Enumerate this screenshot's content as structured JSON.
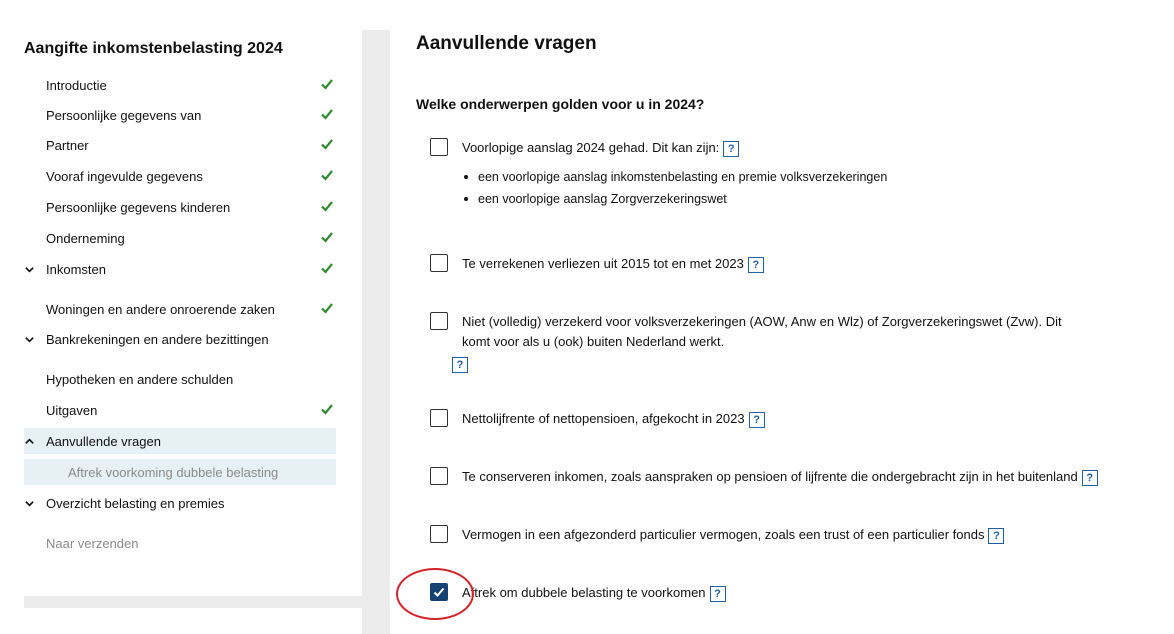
{
  "sidebar": {
    "title": "Aangifte inkomstenbelasting 2024",
    "items": [
      {
        "label": "Introductie",
        "done": true
      },
      {
        "label": "Persoonlijke gegevens van",
        "done": true
      },
      {
        "label": "Partner",
        "done": true
      },
      {
        "label": "Vooraf ingevulde gegevens",
        "done": true
      },
      {
        "label": "Persoonlijke gegevens kinderen",
        "done": true
      },
      {
        "label": "Onderneming",
        "done": true
      },
      {
        "label": "Inkomsten",
        "done": true,
        "expandable": true
      },
      {
        "label": "Woningen en andere onroerende zaken",
        "done": true
      },
      {
        "label": "Bankrekeningen en andere bezittingen",
        "done": false,
        "expandable": true
      },
      {
        "label": "Hypotheken en andere schulden",
        "done": false
      },
      {
        "label": "Uitgaven",
        "done": true
      },
      {
        "label": "Aanvullende vragen",
        "done": false,
        "expandable": true,
        "expanded": true
      },
      {
        "label": "Overzicht belasting en premies",
        "done": false,
        "expandable": true
      },
      {
        "label": "Naar verzenden",
        "done": false,
        "disabled": true
      }
    ],
    "subitem": "Aftrek voorkoming dubbele belasting"
  },
  "main": {
    "title": "Aanvullende vragen",
    "question": "Welke onderwerpen golden voor u in 2024?",
    "help_label": "?",
    "options": [
      {
        "text": "Voorlopige aanslag 2024 gehad. Dit kan zijn:",
        "checked": false,
        "bullets": [
          "een voorlopige aanslag inkomstenbelasting en premie volksverzekeringen",
          "een voorlopige aanslag Zorgverzekeringswet"
        ]
      },
      {
        "text": "Te verrekenen verliezen uit 2015 tot en met 2023",
        "checked": false
      },
      {
        "text": "Niet (volledig) verzekerd voor volksverzekeringen (AOW, Anw en Wlz) of Zorgverzekeringswet (Zvw). Dit komt voor als u (ook) buiten Nederland werkt.",
        "checked": false
      },
      {
        "text": "Nettolijfrente of nettopensioen, afgekocht in 2023",
        "checked": false
      },
      {
        "text": "Te conserveren inkomen, zoals aanspraken op pensioen of lijfrente die ondergebracht zijn in het buitenland",
        "checked": false
      },
      {
        "text": "Vermogen in een afgezonderd particulier vermogen, zoals een trust of een particulier fonds",
        "checked": false
      },
      {
        "text": "Aftrek om dubbele belasting te voorkomen",
        "checked": true
      }
    ]
  },
  "colors": {
    "check_green": "#2e8b2e",
    "checkbox_checked": "#154273",
    "help_blue": "#1f5fa8",
    "annotation_red": "#d3232a",
    "active_bg": "#e7f1f5"
  }
}
